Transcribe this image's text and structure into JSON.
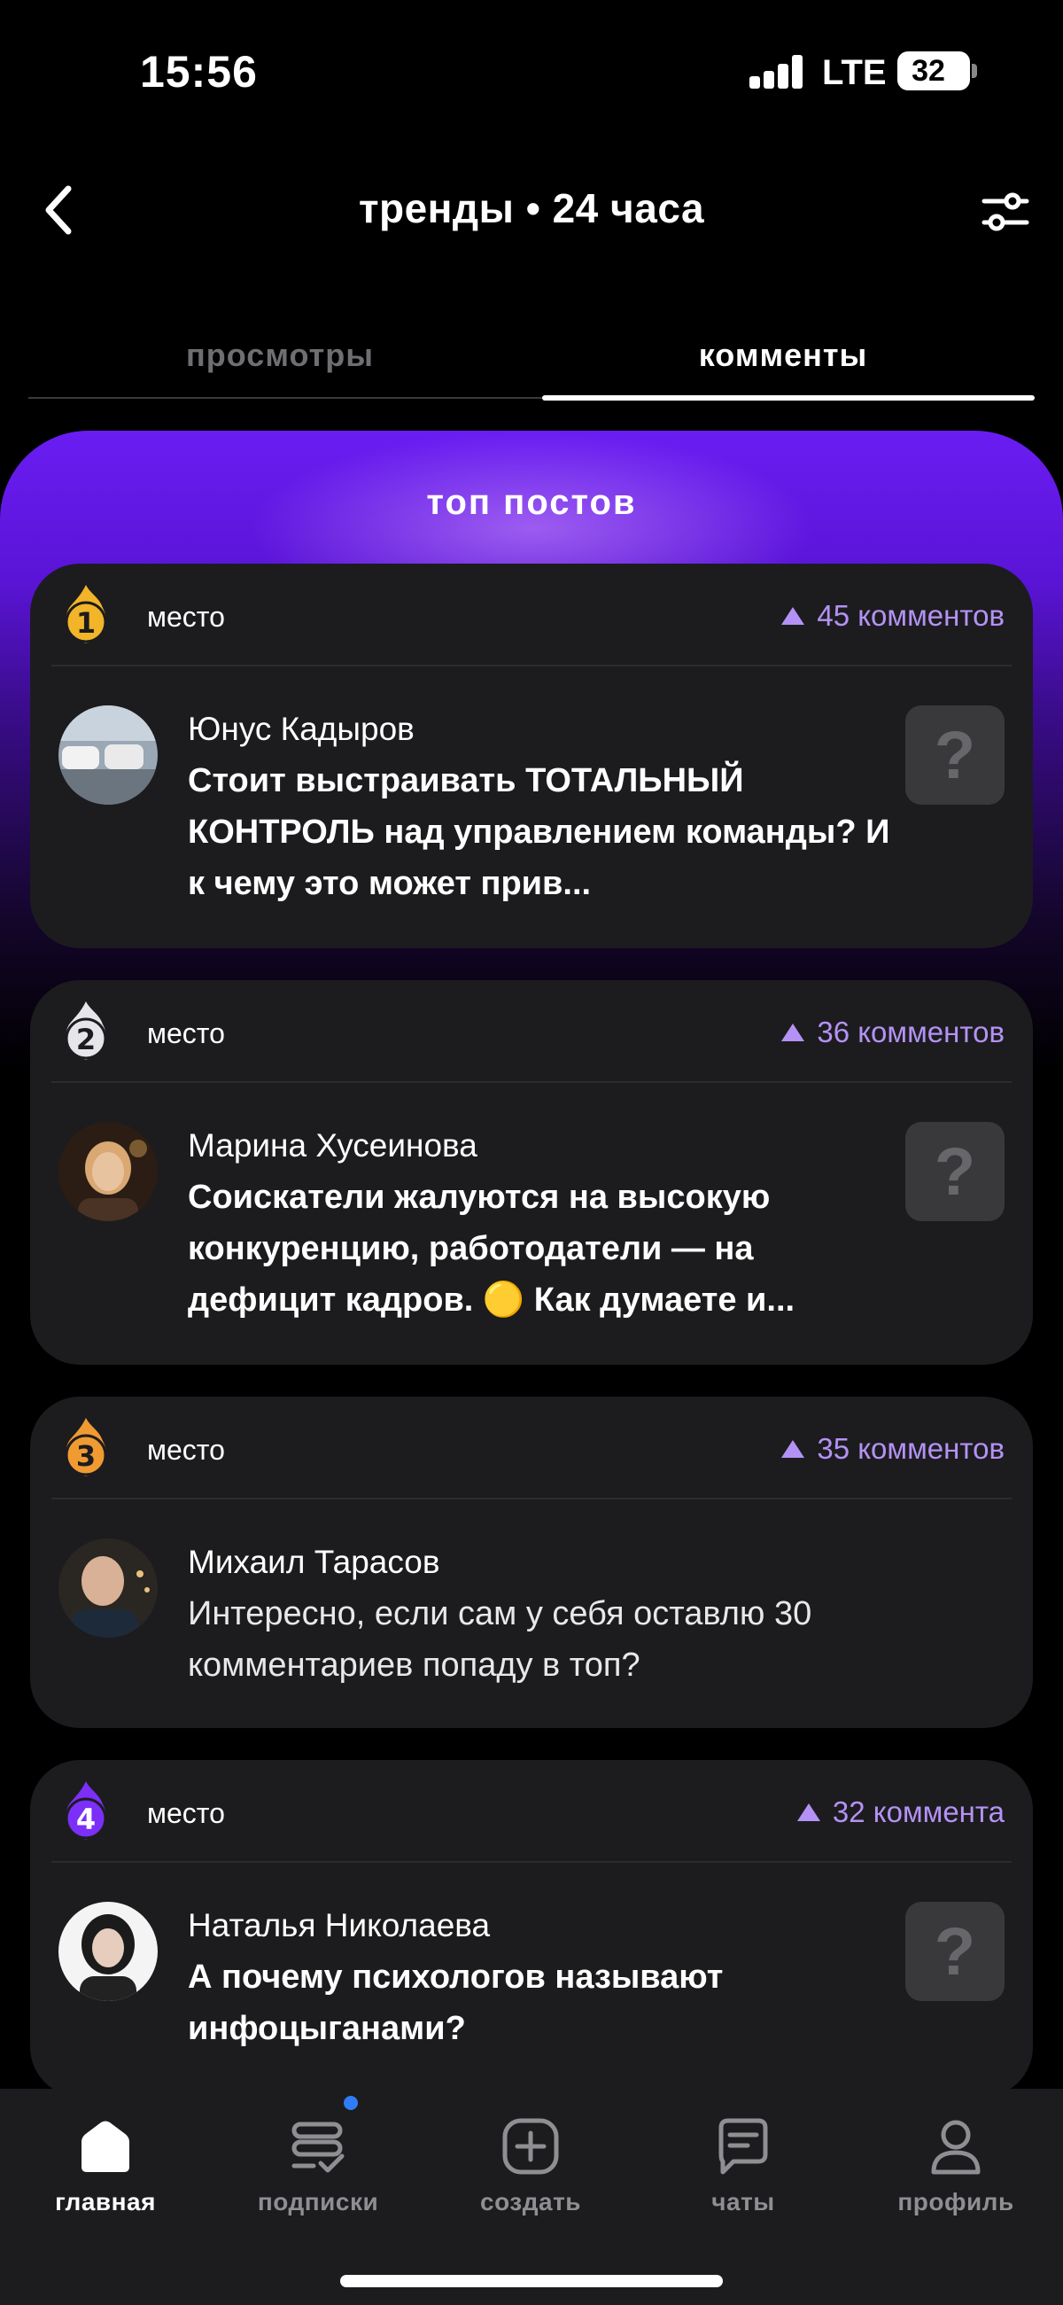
{
  "status_bar": {
    "time": "15:56",
    "network": "LTE",
    "battery": "32"
  },
  "header": {
    "title": "тренды • 24 часа"
  },
  "tabs": [
    {
      "label": "просмотры",
      "active": false
    },
    {
      "label": "комменты",
      "active": true
    }
  ],
  "section": {
    "title": "топ постов"
  },
  "posts": [
    {
      "rank": "1",
      "place_label": "место",
      "count": "45 комментов",
      "author": "Юнус Кадыров",
      "text": "Стоит выстраивать ТОТАЛЬНЫЙ КОНТРОЛЬ над управлением команды? И к чему это может прив...",
      "thumb": "?"
    },
    {
      "rank": "2",
      "place_label": "место",
      "count": "36 комментов",
      "author": "Марина Хусеинова",
      "text": "Соискатели жалуются на высокую конкуренцию, работодатели — на дефицит кадров. 🟡 Как думаете и...",
      "thumb": "?"
    },
    {
      "rank": "3",
      "place_label": "место",
      "count": "35 комментов",
      "author": "Михаил Тарасов",
      "text": "Интересно, если сам у себя оставлю 30 комментариев попаду в топ?",
      "thumb": ""
    },
    {
      "rank": "4",
      "place_label": "место",
      "count": "32 коммента",
      "author": "Наталья Николаева",
      "text": "А почему психологов называют инфоцыганами?",
      "thumb": "?"
    }
  ],
  "colors": {
    "accent": "#b492f5",
    "gold": "#f2b529",
    "silver": "#e5e5ea",
    "bronze": "#f09a32",
    "purple": "#7b2ff7",
    "notification": "#2f7cf6"
  },
  "tabbar": [
    {
      "label": "главная",
      "icon": "home-icon",
      "active": true
    },
    {
      "label": "подписки",
      "icon": "subscriptions-icon",
      "active": false
    },
    {
      "label": "создать",
      "icon": "create-icon",
      "active": false
    },
    {
      "label": "чаты",
      "icon": "chat-icon",
      "active": false
    },
    {
      "label": "профиль",
      "icon": "profile-icon",
      "active": false
    }
  ]
}
